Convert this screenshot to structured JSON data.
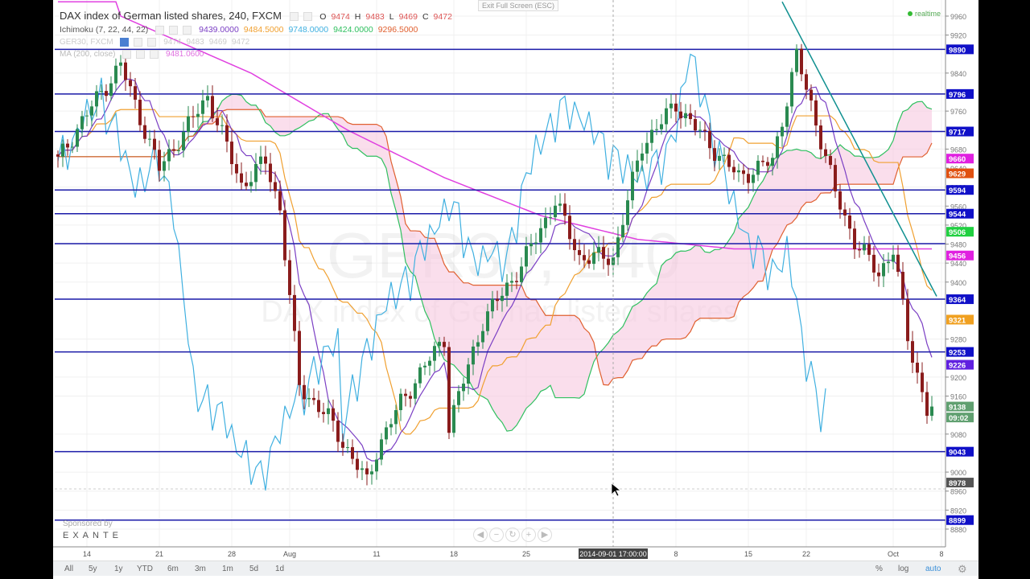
{
  "header": {
    "title": "DAX index of German listed shares, 240, FXCM",
    "ohlc": {
      "o_label": "O",
      "o": "9474",
      "h_label": "H",
      "h": "9483",
      "l_label": "L",
      "l": "9469",
      "c_label": "C",
      "c": "9472"
    },
    "exit_fullscreen": "Exit Full Screen (ESC)",
    "realtime": "realtime"
  },
  "indicators": {
    "ichimoku": {
      "label": "Ichimoku (7, 22, 44, 22)",
      "values": [
        "9439.0000",
        "9484.5000",
        "9748.0000",
        "9424.0000",
        "9296.5000"
      ],
      "colors": [
        "#7b3fc4",
        "#f0a030",
        "#40b0e0",
        "#30c060",
        "#e06030"
      ]
    },
    "symbol": {
      "label": "GER30, FXCM",
      "values": [
        "9474",
        "9483",
        "9469",
        "9472"
      ]
    },
    "ma": {
      "label": "MA (200, close)",
      "value": "9481.0600",
      "color": "#e040e0"
    }
  },
  "watermark": {
    "line1": "GER30, 240",
    "line2": "DAX index of German listed shares"
  },
  "sponsor": {
    "label": "Sponsored by",
    "brand": "EXANTE"
  },
  "nav_buttons": [
    "◀",
    "−",
    "↻",
    "+",
    "▶"
  ],
  "bottom": {
    "ranges": [
      "All",
      "5y",
      "1y",
      "YTD",
      "6m",
      "3m",
      "1m",
      "5d",
      "1d"
    ],
    "percent": "%",
    "log": "log",
    "auto": "auto"
  },
  "chart_data": {
    "type": "candlestick",
    "symbol": "GER30",
    "timeframe": "240",
    "ylim": [
      8860,
      9980
    ],
    "y_ticks": [
      9960,
      9920,
      9840,
      9760,
      9680,
      9640,
      9600,
      9560,
      9520,
      9480,
      9440,
      9400,
      9280,
      9200,
      9160,
      9080,
      9000,
      8960,
      8920,
      8880
    ],
    "x_ticks": [
      {
        "label": "14",
        "bar": 6
      },
      {
        "label": "21",
        "bar": 21
      },
      {
        "label": "28",
        "bar": 36
      },
      {
        "label": "Aug",
        "bar": 48
      },
      {
        "label": "11",
        "bar": 66
      },
      {
        "label": "18",
        "bar": 82
      },
      {
        "label": "25",
        "bar": 97
      },
      {
        "label": "8",
        "bar": 128
      },
      {
        "label": "15",
        "bar": 143
      },
      {
        "label": "22",
        "bar": 155
      },
      {
        "label": "Oct",
        "bar": 173
      },
      {
        "label": "8",
        "bar": 183
      }
    ],
    "crosshair": {
      "label": "2014-09-01 17:00:00",
      "bar": 115,
      "price": 8968
    },
    "bars": 182,
    "close_keypoints": [
      [
        0,
        9655
      ],
      [
        5,
        9740
      ],
      [
        13,
        9858
      ],
      [
        16,
        9774
      ],
      [
        21,
        9638
      ],
      [
        31,
        9791
      ],
      [
        38,
        9604
      ],
      [
        43,
        9655
      ],
      [
        46,
        9554
      ],
      [
        50,
        9181
      ],
      [
        56,
        9114
      ],
      [
        64,
        8978
      ],
      [
        66,
        9046
      ],
      [
        71,
        9147
      ],
      [
        80,
        9283
      ],
      [
        81,
        9097
      ],
      [
        88,
        9317
      ],
      [
        96,
        9435
      ],
      [
        103,
        9571
      ],
      [
        108,
        9452
      ],
      [
        115,
        9452
      ],
      [
        118,
        9571
      ],
      [
        121,
        9689
      ],
      [
        128,
        9774
      ],
      [
        135,
        9689
      ],
      [
        141,
        9621
      ],
      [
        148,
        9655
      ],
      [
        153,
        9875
      ],
      [
        156,
        9774
      ],
      [
        161,
        9588
      ],
      [
        165,
        9486
      ],
      [
        170,
        9418
      ],
      [
        173,
        9469
      ],
      [
        176,
        9283
      ],
      [
        180,
        9130
      ],
      [
        181,
        9138
      ]
    ],
    "horizontal_lines": [
      9890,
      9796,
      9717,
      9594,
      9544,
      9481,
      9364,
      9253,
      9043,
      8899
    ],
    "price_labels": [
      {
        "v": 9890,
        "text": "9890",
        "color": "#1010c8"
      },
      {
        "v": 9796,
        "text": "9796",
        "color": "#1010c8"
      },
      {
        "v": 9717,
        "text": "9717",
        "color": "#1010c8"
      },
      {
        "v": 9660,
        "text": "9660",
        "color": "#e020e0"
      },
      {
        "v": 9629,
        "text": "9629",
        "color": "#e05010"
      },
      {
        "v": 9594,
        "text": "9594",
        "color": "#1010c8"
      },
      {
        "v": 9544,
        "text": "9544",
        "color": "#1010c8"
      },
      {
        "v": 9506,
        "text": "9506",
        "color": "#20d040"
      },
      {
        "v": 9456,
        "text": "9456",
        "color": "#e020e0"
      },
      {
        "v": 9364,
        "text": "9364",
        "color": "#1010c8"
      },
      {
        "v": 9321,
        "text": "9321",
        "color": "#f0a020"
      },
      {
        "v": 9253,
        "text": "9253",
        "color": "#1010c8"
      },
      {
        "v": 9226,
        "text": "9226",
        "color": "#6020e0"
      },
      {
        "v": 9138,
        "text": "9138",
        "color": "#60a070"
      },
      {
        "v": 9115,
        "text": "09:02",
        "color": "#60a070"
      },
      {
        "v": 9043,
        "text": "9043",
        "color": "#1010c8"
      },
      {
        "v": 8978,
        "text": "8978",
        "color": "#555555"
      },
      {
        "v": 8899,
        "text": "8899",
        "color": "#1010c8"
      }
    ],
    "ma200_keypoints": [
      [
        13,
        9960
      ],
      [
        40,
        9840
      ],
      [
        60,
        9720
      ],
      [
        80,
        9620
      ],
      [
        100,
        9540
      ],
      [
        120,
        9490
      ],
      [
        140,
        9470
      ],
      [
        160,
        9470
      ],
      [
        182,
        9470
      ]
    ],
    "tenkan_offset": [
      0,
      20,
      -10,
      15,
      -20,
      10
    ],
    "trendline": {
      "from": [
        150,
        9990
      ],
      "to": [
        182,
        9370
      ],
      "color": "#109090"
    }
  }
}
